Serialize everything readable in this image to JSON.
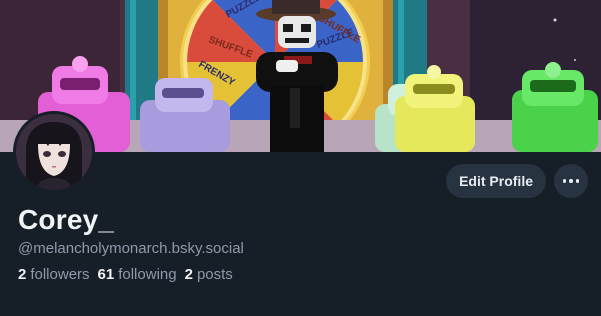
{
  "profile": {
    "display_name": "Corey_",
    "handle": "@melancholymonarch.bsky.social",
    "stats": {
      "followers_count": "2",
      "followers_label": "followers",
      "following_count": "61",
      "following_label": "following",
      "posts_count": "2",
      "posts_label": "posts"
    }
  },
  "actions": {
    "edit_label": "Edit Profile",
    "more_icon": "ellipsis-icon"
  },
  "banner": {
    "wheel_labels": [
      "PUZZLE",
      "SHUFFLE",
      "FRENZY",
      "PUZZLE",
      "SHUFFLE"
    ]
  },
  "colors": {
    "background": "#161e27",
    "button_bg": "#273341",
    "text_primary": "#f1f3f5",
    "text_secondary": "#8d9bab"
  }
}
